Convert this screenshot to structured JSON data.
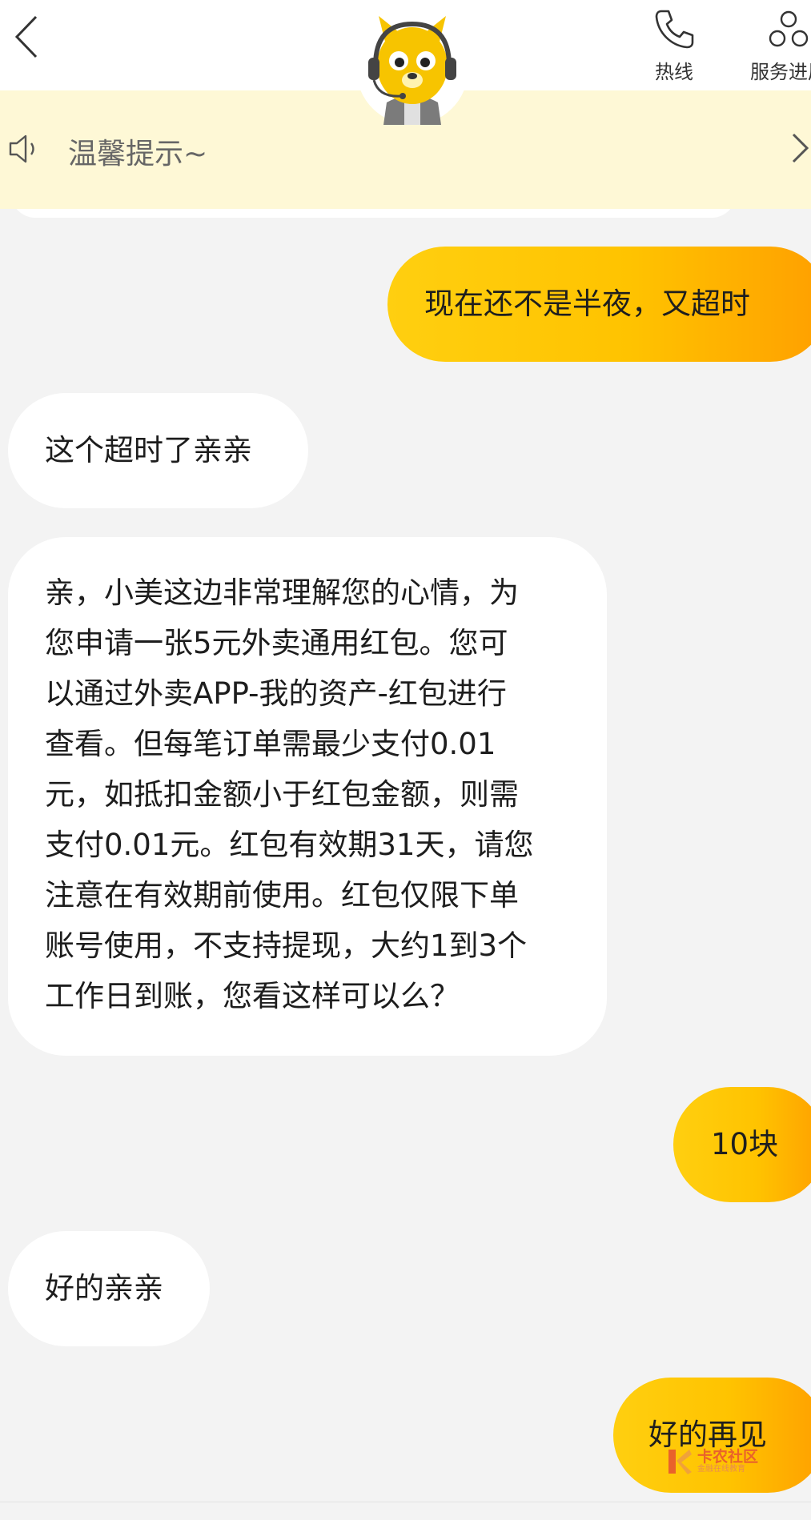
{
  "header": {
    "back_icon": "chevron-left-icon",
    "mascot_icon": "support-mascot-icon",
    "actions": [
      {
        "icon": "phone-icon",
        "label": "热线"
      },
      {
        "icon": "service-progress-icon",
        "label": "服务进展"
      }
    ]
  },
  "notice": {
    "icon": "speaker-icon",
    "text": "温馨提示~",
    "arrow_icon": "chevron-right-icon",
    "background": "#fef8d6"
  },
  "messages": [
    {
      "from": "user",
      "text": "现在还不是半夜，又超时"
    },
    {
      "from": "agent",
      "text": "这个超时了亲亲"
    },
    {
      "from": "agent",
      "text": "亲，小美这边非常理解您的心情，为\n您申请一张5元外卖通用红包。您可\n以通过外卖APP-我的资产-红包进行\n查看。但每笔订单需最少支付0.01\n元，如抵扣金额小于红包金额，则需\n支付0.01元。红包有效期31天，请您\n注意在有效期前使用。红包仅限下单\n账号使用，不支持提现，大约1到3个\n工作日到账，您看这样可以么？"
    },
    {
      "from": "user",
      "text": "10块"
    },
    {
      "from": "agent",
      "text": "好的亲亲"
    },
    {
      "from": "user",
      "text": "好的再见"
    }
  ],
  "watermark": {
    "main": "卡农社区",
    "sub": "金融在线教育"
  },
  "colors": {
    "user_bubble_start": "#ffcf10",
    "user_bubble_end": "#ff9f00",
    "agent_bubble": "#ffffff",
    "page_bg": "#f3f3f3"
  }
}
